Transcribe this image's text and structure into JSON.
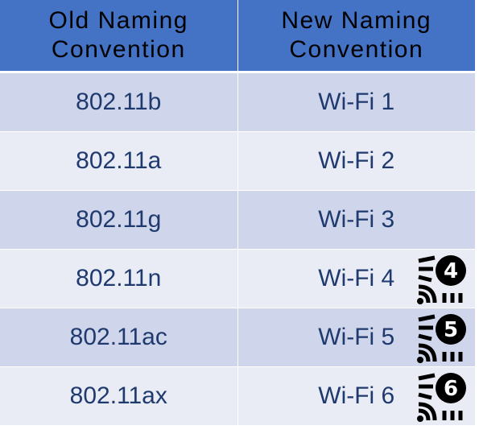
{
  "header": {
    "old_line1": "Old Naming",
    "old_line2": "Convention",
    "new_line1": "New Naming",
    "new_line2": "Convention"
  },
  "rows": [
    {
      "old": "802.11b",
      "new": "Wi-Fi 1",
      "badge_icon": ""
    },
    {
      "old": "802.11a",
      "new": "Wi-Fi 2",
      "badge_icon": ""
    },
    {
      "old": "802.11g",
      "new": "Wi-Fi 3",
      "badge_icon": ""
    },
    {
      "old": "802.11n",
      "new": "Wi-Fi 4",
      "badge_icon": "wifi-4-icon",
      "badge_number": "4"
    },
    {
      "old": "802.11ac",
      "new": "Wi-Fi 5",
      "badge_icon": "wifi-5-icon",
      "badge_number": "5"
    },
    {
      "old": "802.11ax",
      "new": "Wi-Fi 6",
      "badge_icon": "wifi-6-icon",
      "badge_number": "6"
    }
  ],
  "colors": {
    "header_bg": "#4472c4",
    "row_dark": "#cfd5ea",
    "row_light": "#e9ebf5",
    "cell_text": "#1f3a6e"
  }
}
